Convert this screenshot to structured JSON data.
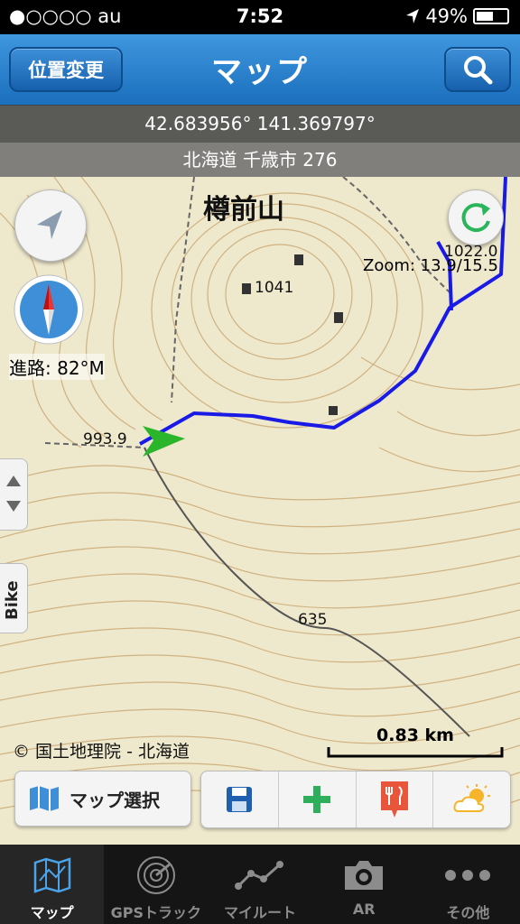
{
  "status": {
    "carrier": "●○○○○ au",
    "time": "7:52",
    "battery": "49%",
    "battery_level": 0.49
  },
  "navbar": {
    "left_button": "位置変更",
    "title": "マップ",
    "search_icon": "search-icon"
  },
  "info": {
    "coordinates": "42.683956° 141.369797°",
    "address": "北海道 千歳市 276"
  },
  "map": {
    "labels": {
      "mountain": "樽前山",
      "peak1": "1041",
      "peak2": "1022.0",
      "peak3": "993.9",
      "elev": "635"
    },
    "zoom": "Zoom: 13.9/15.5",
    "heading": "進路: 82°M",
    "side_label": "Bike",
    "attribution": "© 国土地理院 - 北海道",
    "scale": "0.83 km",
    "track_color": "#1a1ae6",
    "marker_color": "#2bb52b"
  },
  "toolbar": {
    "select_label": "マップ選択",
    "icons": [
      "map-icon",
      "save-icon",
      "plus-icon",
      "restaurant-icon",
      "weather-icon"
    ]
  },
  "tabs": [
    {
      "label": "マップ",
      "icon": "map-icon",
      "active": true
    },
    {
      "label": "GPSトラック",
      "icon": "radar-icon",
      "active": false
    },
    {
      "label": "マイルート",
      "icon": "route-icon",
      "active": false
    },
    {
      "label": "AR",
      "icon": "camera-icon",
      "active": false
    },
    {
      "label": "その他",
      "icon": "more-icon",
      "active": false
    }
  ]
}
